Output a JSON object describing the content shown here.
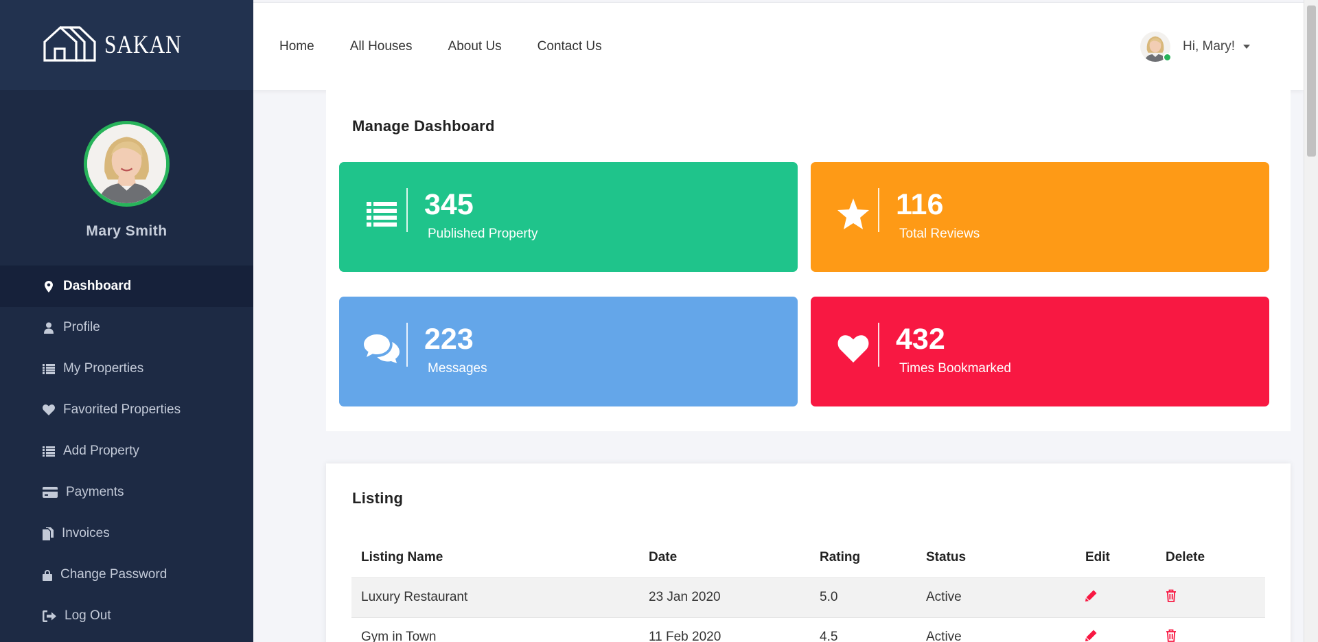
{
  "brand": {
    "name": "SAKAN",
    "icon": "house-logo-icon"
  },
  "profile": {
    "name": "Mary Smith"
  },
  "sidebar": {
    "items": [
      {
        "label": "Dashboard",
        "icon": "map-marker-icon",
        "active": true
      },
      {
        "label": "Profile",
        "icon": "user-icon"
      },
      {
        "label": "My Properties",
        "icon": "list-icon"
      },
      {
        "label": "Favorited Properties",
        "icon": "heart-icon"
      },
      {
        "label": "Add Property",
        "icon": "list-icon"
      },
      {
        "label": "Payments",
        "icon": "credit-card-icon"
      },
      {
        "label": "Invoices",
        "icon": "files-icon"
      },
      {
        "label": "Change Password",
        "icon": "lock-icon"
      },
      {
        "label": "Log Out",
        "icon": "sign-out-icon"
      }
    ]
  },
  "nav": {
    "links": [
      "Home",
      "All Houses",
      "About Us",
      "Contact Us"
    ],
    "greeting": "Hi, Mary!"
  },
  "dashboard": {
    "title": "Manage Dashboard",
    "stats": [
      {
        "value": "345",
        "label": "Published Property",
        "color": "#1fc48b",
        "icon": "list-icon"
      },
      {
        "value": "116",
        "label": "Total Reviews",
        "color": "#fe9a16",
        "icon": "star-icon"
      },
      {
        "value": "223",
        "label": "Messages",
        "color": "#64a6e9",
        "icon": "comments-icon"
      },
      {
        "value": "432",
        "label": "Times Bookmarked",
        "color": "#f81842",
        "icon": "heart-icon"
      }
    ]
  },
  "listing": {
    "title": "Listing",
    "columns": [
      "Listing Name",
      "Date",
      "Rating",
      "Status",
      "Edit",
      "Delete"
    ],
    "rows": [
      {
        "name": "Luxury Restaurant",
        "date": "23 Jan 2020",
        "rating": "5.0",
        "status": "Active"
      },
      {
        "name": "Gym in Town",
        "date": "11 Feb 2020",
        "rating": "4.5",
        "status": "Active"
      }
    ],
    "edit_icon": "pencil-icon",
    "delete_icon": "trash-icon",
    "action_color": "#f81842"
  },
  "colors": {
    "sidebar": "#1d2a44",
    "accent_green": "#27b35a"
  }
}
